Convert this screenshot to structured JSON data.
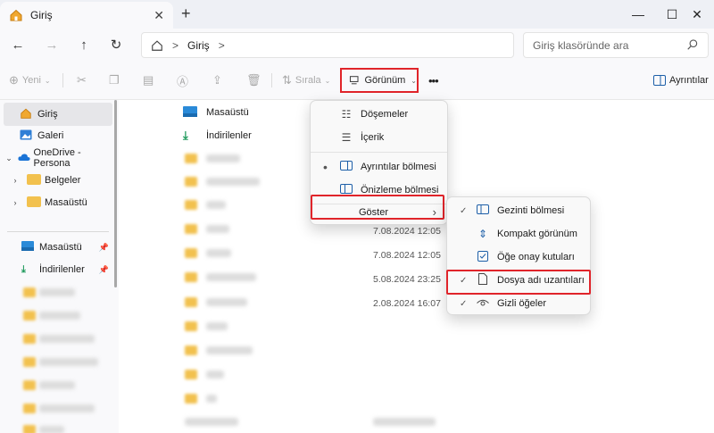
{
  "window": {
    "tab_title": "Giriş",
    "tab_close": "✕",
    "new_tab": "+",
    "minimize": "—",
    "maximize": "☐",
    "close": "✕"
  },
  "nav": {
    "back": "←",
    "forward": "→",
    "up": "↑",
    "refresh": "↻",
    "breadcrumb_home_icon": "home-icon",
    "breadcrumb": "Giriş",
    "sep": ">",
    "search_placeholder": "Giriş klasöründe ara"
  },
  "toolbar": {
    "new_label": "Yeni",
    "sort_label": "Sırala",
    "view_label": "Görünüm",
    "more_label": "•••",
    "details_label": "Ayrıntılar"
  },
  "sidebar": {
    "items": [
      {
        "label": "Giriş"
      },
      {
        "label": "Galeri"
      },
      {
        "label": "OneDrive - Persona"
      },
      {
        "label": "Belgeler"
      },
      {
        "label": "Masaüstü"
      },
      {
        "label": "Masaüstü"
      },
      {
        "label": "İndirilenler"
      }
    ]
  },
  "main": {
    "files": [
      {
        "name": "Masaüstü",
        "date": ""
      },
      {
        "name": "İndirilenler",
        "date": ""
      }
    ],
    "dates": [
      "7.08.2024 12:05",
      "7.08.2024 12:05",
      "5.08.2024 23:25",
      "2.08.2024 16:07"
    ]
  },
  "view_menu": {
    "items": [
      {
        "label": "Döşemeler",
        "icon": "tiles-icon"
      },
      {
        "label": "İçerik",
        "icon": "content-icon"
      },
      {
        "label": "Ayrıntılar bölmesi",
        "icon": "details-pane-icon",
        "selected": true
      },
      {
        "label": "Önizleme bölmesi",
        "icon": "preview-pane-icon"
      },
      {
        "label": "Göster",
        "submenu_arrow": "›"
      }
    ]
  },
  "show_menu": {
    "items": [
      {
        "label": "Gezinti bölmesi",
        "checked": true
      },
      {
        "label": "Kompakt görünüm",
        "checked": false
      },
      {
        "label": "Öğe onay kutuları",
        "checked": false
      },
      {
        "label": "Dosya adı uzantıları",
        "checked": true
      },
      {
        "label": "Gizli öğeler",
        "checked": true
      }
    ]
  },
  "colors": {
    "highlight": "#e0242a",
    "folder": "#f2c14e",
    "accent": "#1d5fa8"
  }
}
